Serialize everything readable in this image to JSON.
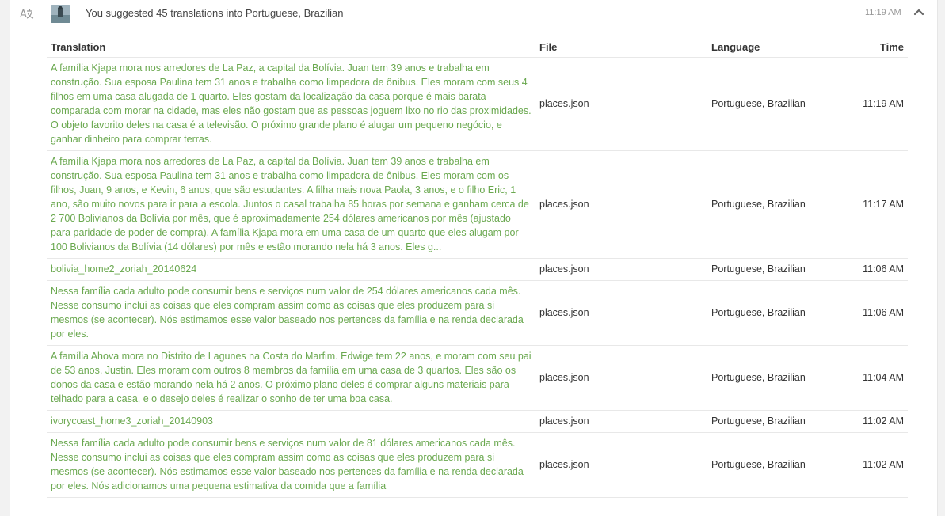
{
  "activity": {
    "summary": "You suggested 45 translations into Portuguese, Brazilian",
    "time": "11:19 AM",
    "icon": "translate-icon",
    "collapse_icon": "chevron-up-icon",
    "accent_color": "#6aa84f"
  },
  "table": {
    "headers": {
      "translation": "Translation",
      "file": "File",
      "language": "Language",
      "time": "Time"
    },
    "rows": [
      {
        "translation": "A família Kjapa mora nos arredores de La Paz, a capital da Bolívia. Juan tem 39 anos e trabalha em construção. Sua esposa Paulina tem 31 anos e trabalha como limpadora de ônibus. Eles moram com seus 4 filhos em uma casa alugada de 1 quarto. Eles gostam da localização da casa porque é mais barata comparada com morar na cidade, mas eles não gostam que as pessoas joguem lixo no rio das proximidades. O objeto favorito deles na casa é a televisão. O próximo grande plano é alugar um pequeno negócio, e ganhar dinheiro para comprar terras.",
        "file": "places.json",
        "language": "Portuguese, Brazilian",
        "time": "11:19 AM"
      },
      {
        "translation": "A família Kjapa mora nos arredores de La Paz, a capital da Bolívia. Juan tem 39 anos e trabalha em construção. Sua esposa Paulina tem 31 anos e trabalha como limpadora de ônibus. Eles moram com os filhos, Juan, 9 anos, e Kevin, 6 anos, que são estudantes. A filha mais nova Paola, 3 anos, e o filho Eric, 1 ano, são muito novos para ir para a escola. Juntos o casal trabalha 85 horas por semana e ganham cerca de 2 700 Bolivianos da Bolívia por mês, que é aproximadamente 254 dólares americanos por mês (ajustado para paridade de poder de compra). A família Kjapa mora em uma casa de um quarto que eles alugam por 100 Bolivianos da Bolívia (14 dólares) por mês e estão morando nela há 3 anos. Eles g...",
        "file": "places.json",
        "language": "Portuguese, Brazilian",
        "time": "11:17 AM"
      },
      {
        "translation": "bolivia_home2_zoriah_20140624",
        "file": "places.json",
        "language": "Portuguese, Brazilian",
        "time": "11:06 AM"
      },
      {
        "translation": "Nessa família cada adulto pode consumir bens e serviços num valor de 254 dólares americanos cada mês. Nesse consumo inclui as coisas que eles compram assim como as coisas que eles produzem para si mesmos (se acontecer). Nós estimamos esse valor baseado nos pertences da família e na renda declarada por eles.",
        "file": "places.json",
        "language": "Portuguese, Brazilian",
        "time": "11:06 AM"
      },
      {
        "translation": "A família Ahova mora no Distrito de Lagunes na Costa do Marfim. Edwige tem 22 anos, e moram com seu pai de 53 anos, Justin. Eles moram com outros 8 membros da família em uma casa de 3 quartos. Eles são os donos da casa e estão morando nela há 2 anos. O próximo plano deles é comprar alguns materiais para telhado para a casa, e o desejo deles é realizar o sonho de ter uma boa casa.",
        "file": "places.json",
        "language": "Portuguese, Brazilian",
        "time": "11:04 AM"
      },
      {
        "translation": "ivorycoast_home3_zoriah_20140903",
        "file": "places.json",
        "language": "Portuguese, Brazilian",
        "time": "11:02 AM"
      },
      {
        "translation": "Nessa família cada adulto pode consumir bens e serviços num valor de 81 dólares americanos cada mês. Nesse consumo inclui as coisas que eles compram assim como as coisas que eles produzem para si mesmos (se acontecer). Nós estimamos esse valor baseado nos pertences da família e na renda declarada por eles. Nós adicionamos uma pequena estimativa da comida que a família",
        "file": "places.json",
        "language": "Portuguese, Brazilian",
        "time": "11:02 AM"
      }
    ]
  }
}
